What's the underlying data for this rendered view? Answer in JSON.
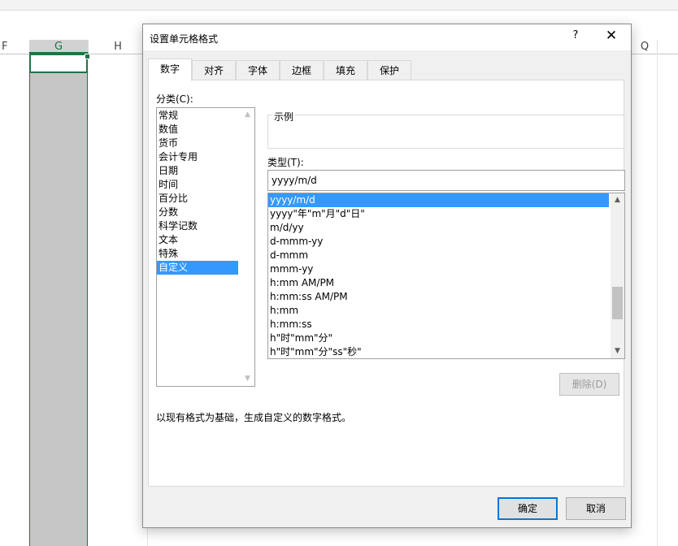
{
  "spreadsheet": {
    "columns": [
      "F",
      "G",
      "H",
      "Q"
    ],
    "selected_column": "G"
  },
  "dialog": {
    "title": "设置单元格格式",
    "help_label": "?",
    "close_label": "✕",
    "tabs": [
      {
        "label": "数字",
        "active": true
      },
      {
        "label": "对齐"
      },
      {
        "label": "字体"
      },
      {
        "label": "边框"
      },
      {
        "label": "填充"
      },
      {
        "label": "保护"
      }
    ],
    "category": {
      "label": "分类(C):",
      "items": [
        "常规",
        "数值",
        "货币",
        "会计专用",
        "日期",
        "时间",
        "百分比",
        "分数",
        "科学记数",
        "文本",
        "特殊",
        "自定义"
      ],
      "selected": "自定义"
    },
    "sample": {
      "label": "示例"
    },
    "type": {
      "label": "类型(T):",
      "value": "yyyy/m/d",
      "items": [
        "yyyy/m/d",
        "yyyy\"年\"m\"月\"d\"日\"",
        "m/d/yy",
        "d-mmm-yy",
        "d-mmm",
        "mmm-yy",
        "h:mm AM/PM",
        "h:mm:ss AM/PM",
        "h:mm",
        "h:mm:ss",
        "h\"时\"mm\"分\"",
        "h\"时\"mm\"分\"ss\"秒\""
      ],
      "selected": "yyyy/m/d"
    },
    "delete_label": "删除(D)",
    "description": "以现有格式为基础，生成自定义的数字格式。",
    "ok_label": "确定",
    "cancel_label": "取消"
  }
}
